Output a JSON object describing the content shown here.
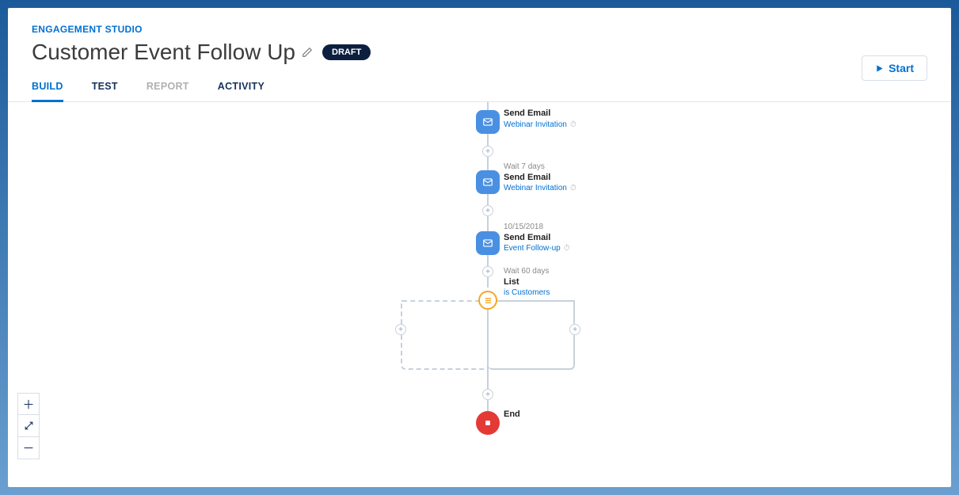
{
  "breadcrumb": "ENGAGEMENT STUDIO",
  "title": "Customer Event Follow Up",
  "status_badge": "DRAFT",
  "start_button": "Start",
  "tabs": [
    "BUILD",
    "TEST",
    "REPORT",
    "ACTIVITY"
  ],
  "active_tab_index": 0,
  "disabled_tab_index": 2,
  "nodes": [
    {
      "meta": "",
      "title": "Send Email",
      "link": "Webinar Invitation",
      "has_clock": true
    },
    {
      "meta": "Wait 7 days",
      "title": "Send Email",
      "link": "Webinar Invitation",
      "has_clock": true
    },
    {
      "meta": "10/15/2018",
      "title": "Send Email",
      "link": "Event Follow-up",
      "has_clock": true
    },
    {
      "meta": "Wait 60 days",
      "title": "List",
      "link": "is Customers",
      "has_clock": false
    }
  ],
  "end_label": "End"
}
